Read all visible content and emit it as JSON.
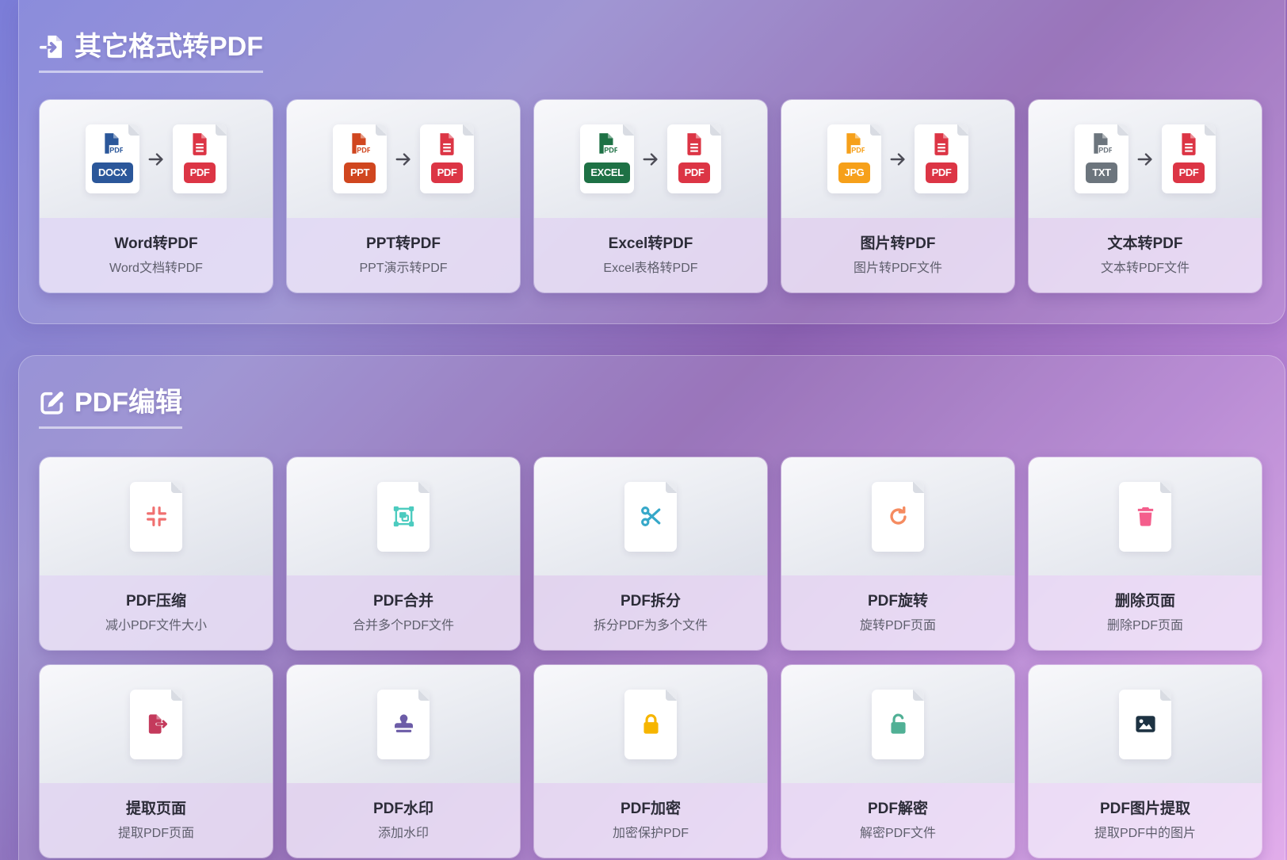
{
  "sections": [
    {
      "title": "其它格式转PDF",
      "icon": "file-import-icon",
      "cards": [
        {
          "title": "Word转PDF",
          "subtitle": "Word文档转PDF",
          "from": {
            "icon": "word-file-icon",
            "glyph_label": "PDF",
            "badge": "DOCX",
            "color": "#2b579a"
          },
          "to": {
            "icon": "pdf-file-icon",
            "badge": "PDF",
            "color": "#dc3545"
          }
        },
        {
          "title": "PPT转PDF",
          "subtitle": "PPT演示转PDF",
          "from": {
            "icon": "ppt-file-icon",
            "glyph_label": "PDF",
            "badge": "PPT",
            "color": "#d0461f"
          },
          "to": {
            "icon": "pdf-file-icon",
            "badge": "PDF",
            "color": "#dc3545"
          }
        },
        {
          "title": "Excel转PDF",
          "subtitle": "Excel表格转PDF",
          "from": {
            "icon": "excel-file-icon",
            "glyph_label": "PDF",
            "badge": "EXCEL",
            "color": "#1e7145"
          },
          "to": {
            "icon": "pdf-file-icon",
            "badge": "PDF",
            "color": "#dc3545"
          }
        },
        {
          "title": "图片转PDF",
          "subtitle": "图片转PDF文件",
          "from": {
            "icon": "image-file-icon",
            "glyph_label": "PDF",
            "badge": "JPG",
            "color": "#f6a01a"
          },
          "to": {
            "icon": "pdf-file-icon",
            "badge": "PDF",
            "color": "#dc3545"
          }
        },
        {
          "title": "文本转PDF",
          "subtitle": "文本转PDF文件",
          "from": {
            "icon": "text-file-icon",
            "glyph_label": "PDF",
            "badge": "TXT",
            "color": "#6c757d"
          },
          "to": {
            "icon": "pdf-file-icon",
            "badge": "PDF",
            "color": "#dc3545"
          }
        }
      ]
    },
    {
      "title": "PDF编辑",
      "icon": "edit-icon",
      "cards": [
        {
          "title": "PDF压缩",
          "subtitle": "减小PDF文件大小",
          "icon": "compress-icon",
          "color": "#f07070"
        },
        {
          "title": "PDF合并",
          "subtitle": "合并多个PDF文件",
          "icon": "object-group-icon",
          "color": "#4ccbbf"
        },
        {
          "title": "PDF拆分",
          "subtitle": "拆分PDF为多个文件",
          "icon": "scissors-icon",
          "color": "#36a8c9"
        },
        {
          "title": "PDF旋转",
          "subtitle": "旋转PDF页面",
          "icon": "rotate-right-icon",
          "color": "#f58b60"
        },
        {
          "title": "删除页面",
          "subtitle": "删除PDF页面",
          "icon": "trash-icon",
          "color": "#f45e8c"
        },
        {
          "title": "提取页面",
          "subtitle": "提取PDF页面",
          "icon": "file-export-icon",
          "color": "#c43a5c"
        },
        {
          "title": "PDF水印",
          "subtitle": "添加水印",
          "icon": "stamp-icon",
          "color": "#6c5ca7"
        },
        {
          "title": "PDF加密",
          "subtitle": "加密保护PDF",
          "icon": "lock-icon",
          "color": "#f6b500"
        },
        {
          "title": "PDF解密",
          "subtitle": "解密PDF文件",
          "icon": "unlock-icon",
          "color": "#50b095"
        },
        {
          "title": "PDF图片提取",
          "subtitle": "提取PDF中的图片",
          "icon": "image-icon",
          "color": "#1d3242"
        }
      ]
    }
  ]
}
